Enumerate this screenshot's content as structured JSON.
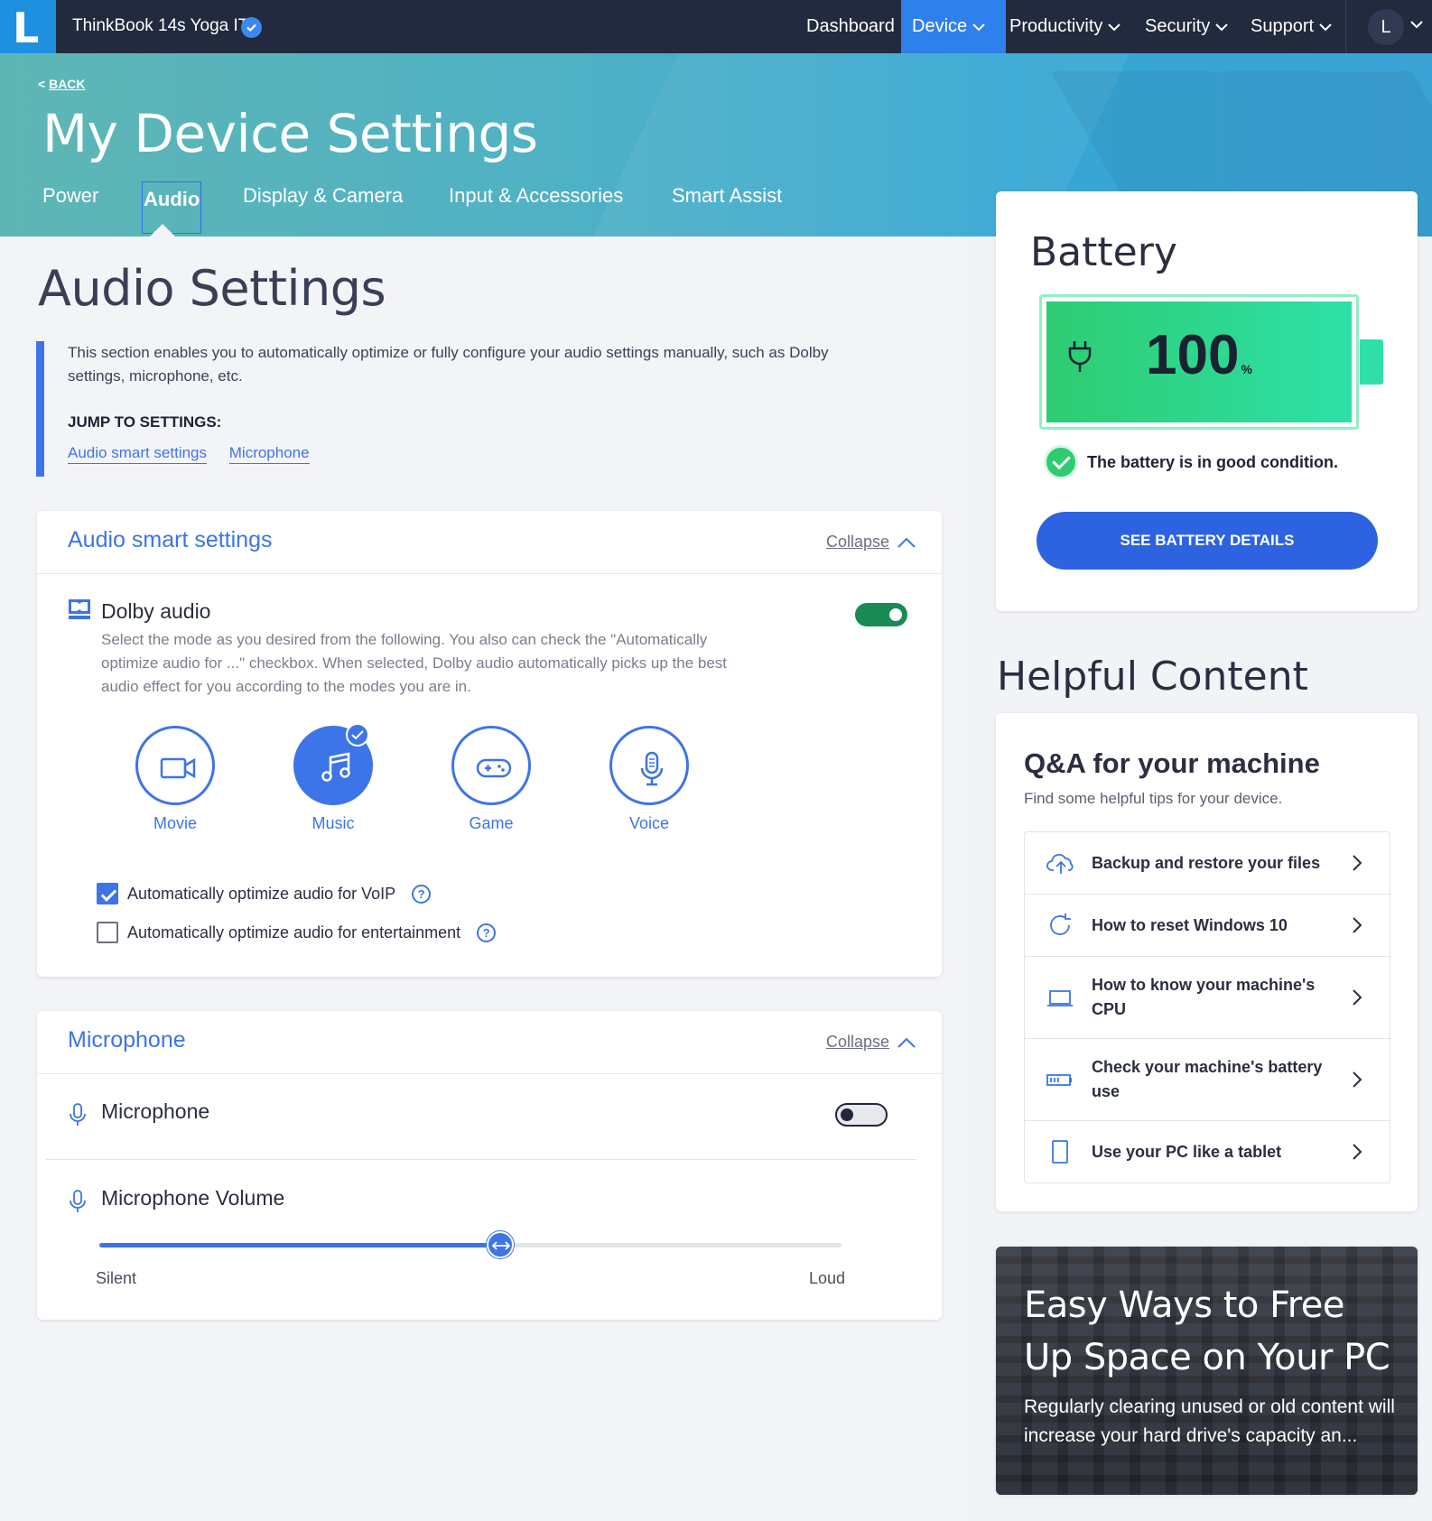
{
  "app": {
    "logo_letter": "L",
    "device_name": "ThinkBook 14s Yoga ITL",
    "nav": {
      "dashboard": "Dashboard",
      "device": "Device",
      "productivity": "Productivity",
      "security": "Security",
      "support": "Support"
    },
    "avatar": "L"
  },
  "hero": {
    "back": "BACK",
    "title": "My Device Settings",
    "tabs": [
      "Power",
      "Audio",
      "Display & Camera",
      "Input & Accessories",
      "Smart Assist"
    ],
    "active_tab": "Audio"
  },
  "audio": {
    "title": "Audio Settings",
    "intro": "This section enables you to automatically optimize or fully configure your audio settings manually, such as Dolby settings, microphone, etc.",
    "jump_label": "JUMP TO SETTINGS:",
    "jump_links": [
      "Audio smart settings",
      "Microphone"
    ],
    "smart": {
      "title": "Audio smart settings",
      "collapse": "Collapse",
      "dolby_title": "Dolby audio",
      "dolby_desc": "Select the mode as you desired from the following. You also can check the \"Automatically optimize audio for ...\" checkbox. When selected, Dolby audio automatically picks up the best audio effect for you according to the modes you are in.",
      "dolby_enabled": true,
      "modes": [
        "Movie",
        "Music",
        "Game",
        "Voice"
      ],
      "selected_mode": "Music",
      "check_voip": "Automatically optimize audio for VoIP",
      "check_voip_on": true,
      "check_ent": "Automatically optimize audio for entertainment",
      "check_ent_on": false
    },
    "mic": {
      "title": "Microphone",
      "collapse": "Collapse",
      "row_title": "Microphone",
      "enabled": false,
      "volume_title": "Microphone Volume",
      "volume_fraction": 0.54,
      "min_label": "Silent",
      "max_label": "Loud"
    }
  },
  "battery": {
    "title": "Battery",
    "percent": "100",
    "unit": "%",
    "status": "The battery is in good condition.",
    "button": "SEE BATTERY DETAILS"
  },
  "helpful": {
    "title": "Helpful Content",
    "qa_title": "Q&A for your machine",
    "qa_sub": "Find some helpful tips for your device.",
    "items": [
      {
        "label": "Backup and restore your files",
        "icon": "cloud-upload-icon"
      },
      {
        "label": "How to reset Windows 10",
        "icon": "refresh-icon"
      },
      {
        "label": "How to know your machine's CPU",
        "icon": "laptop-icon"
      },
      {
        "label": "Check your machine's battery use",
        "icon": "battery-icon"
      },
      {
        "label": "Use your PC like a tablet",
        "icon": "tablet-icon"
      }
    ],
    "promo_title": "Easy Ways to Free Up Space on Your PC",
    "promo_text": "Regularly clearing unused or old content will increase your hard drive's capacity an..."
  },
  "colors": {
    "accent": "#3d74e8",
    "topbar": "#222a3d",
    "battery_green": "#2ecc71",
    "toggle_on": "#1a8a55"
  }
}
